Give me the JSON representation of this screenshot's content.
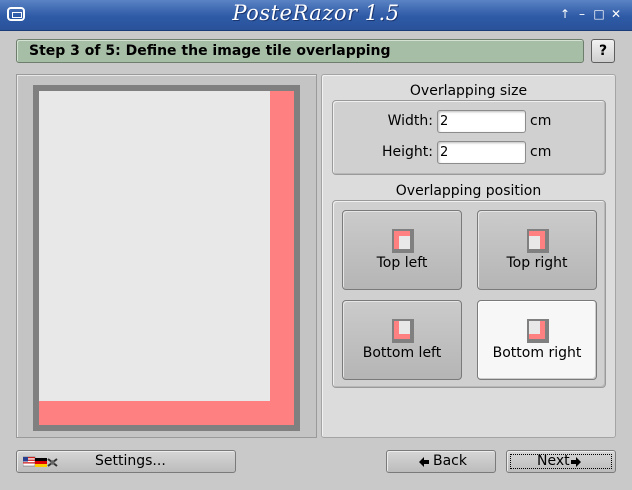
{
  "window": {
    "title": "PosteRazor 1.5",
    "controls": [
      "↑",
      "–",
      "□",
      "✕"
    ]
  },
  "step": {
    "text": "Step 3 of 5: Define the image tile overlapping",
    "help_label": "?"
  },
  "overlapping_size": {
    "title": "Overlapping size",
    "width_label": "Width:",
    "width_value": "2",
    "height_label": "Height:",
    "height_value": "2",
    "unit": "cm"
  },
  "overlapping_position": {
    "title": "Overlapping position",
    "buttons": [
      {
        "label": "Top left",
        "selected": false
      },
      {
        "label": "Top right",
        "selected": false
      },
      {
        "label": "Bottom left",
        "selected": false
      },
      {
        "label": "Bottom right",
        "selected": true
      }
    ]
  },
  "footer": {
    "settings_label": "Settings...",
    "back_label": "Back",
    "next_label": "Next"
  },
  "colors": {
    "overlap": "#ff8080",
    "frame": "#808080",
    "page": "#e8e8e8",
    "step_bar": "#a7bea6",
    "title_bar": "#2e5aa6"
  }
}
